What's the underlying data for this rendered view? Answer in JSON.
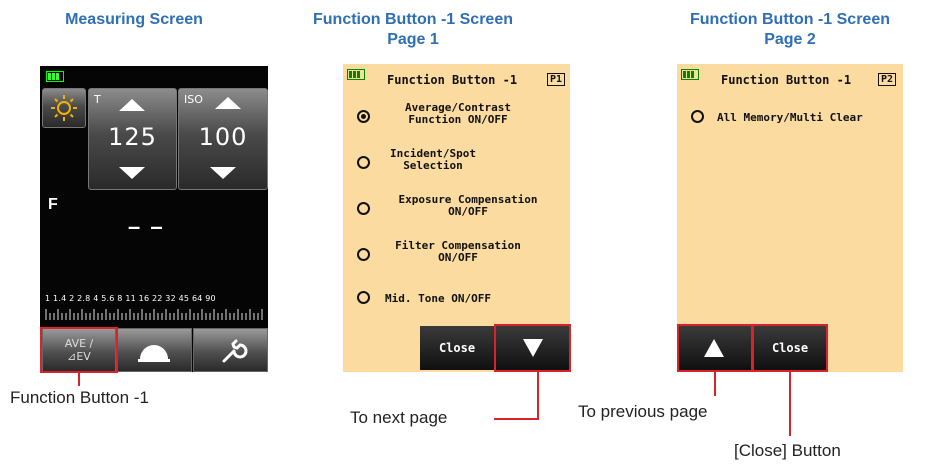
{
  "headings": {
    "measuring": "Measuring Screen",
    "fn_page1_line1": "Function Button -1 Screen",
    "fn_page1_line2": "Page 1",
    "fn_page2_line1": "Function Button -1 Screen",
    "fn_page2_line2": "Page 2"
  },
  "measuring_screen": {
    "t_label": "T",
    "t_value": "125",
    "iso_label": "ISO",
    "iso_value": "100",
    "f_label": "F",
    "f_value": "– –",
    "aperture_scale": "1 1.4 2 2.8 4 5.6 8 11 16 22 32 45 64 90",
    "ave_line1": "AVE /",
    "ave_line2": "⊿EV",
    "icons": [
      "sun-icon",
      "up-arrow-icon",
      "down-arrow-icon",
      "dome-icon",
      "wrench-icon",
      "battery-icon"
    ]
  },
  "page1": {
    "title": "Function Button -1",
    "page_tag": "P1",
    "options": [
      {
        "line1": "Average/Contrast",
        "line2": "Function ON/OFF",
        "selected": true
      },
      {
        "line1": "Incident/Spot",
        "line2": "Selection",
        "selected": false
      },
      {
        "line1": "Exposure Compensation",
        "line2": "ON/OFF",
        "selected": false
      },
      {
        "line1": "Filter Compensation",
        "line2": "ON/OFF",
        "selected": false
      },
      {
        "line1": "Mid. Tone ON/OFF",
        "line2": "",
        "selected": false
      }
    ],
    "close_label": "Close"
  },
  "page2": {
    "title": "Function Button -1",
    "page_tag": "P2",
    "options": [
      {
        "line1": "All Memory/Multi Clear",
        "selected": false
      }
    ],
    "close_label": "Close"
  },
  "captions": {
    "function_button": "Function Button -1",
    "next_page": "To next page",
    "previous_page": "To previous page",
    "close_button": "[Close] Button"
  },
  "colors": {
    "heading": "#2e6fb5",
    "callout": "#d8232a",
    "screen_bg": "#fbdba0"
  }
}
